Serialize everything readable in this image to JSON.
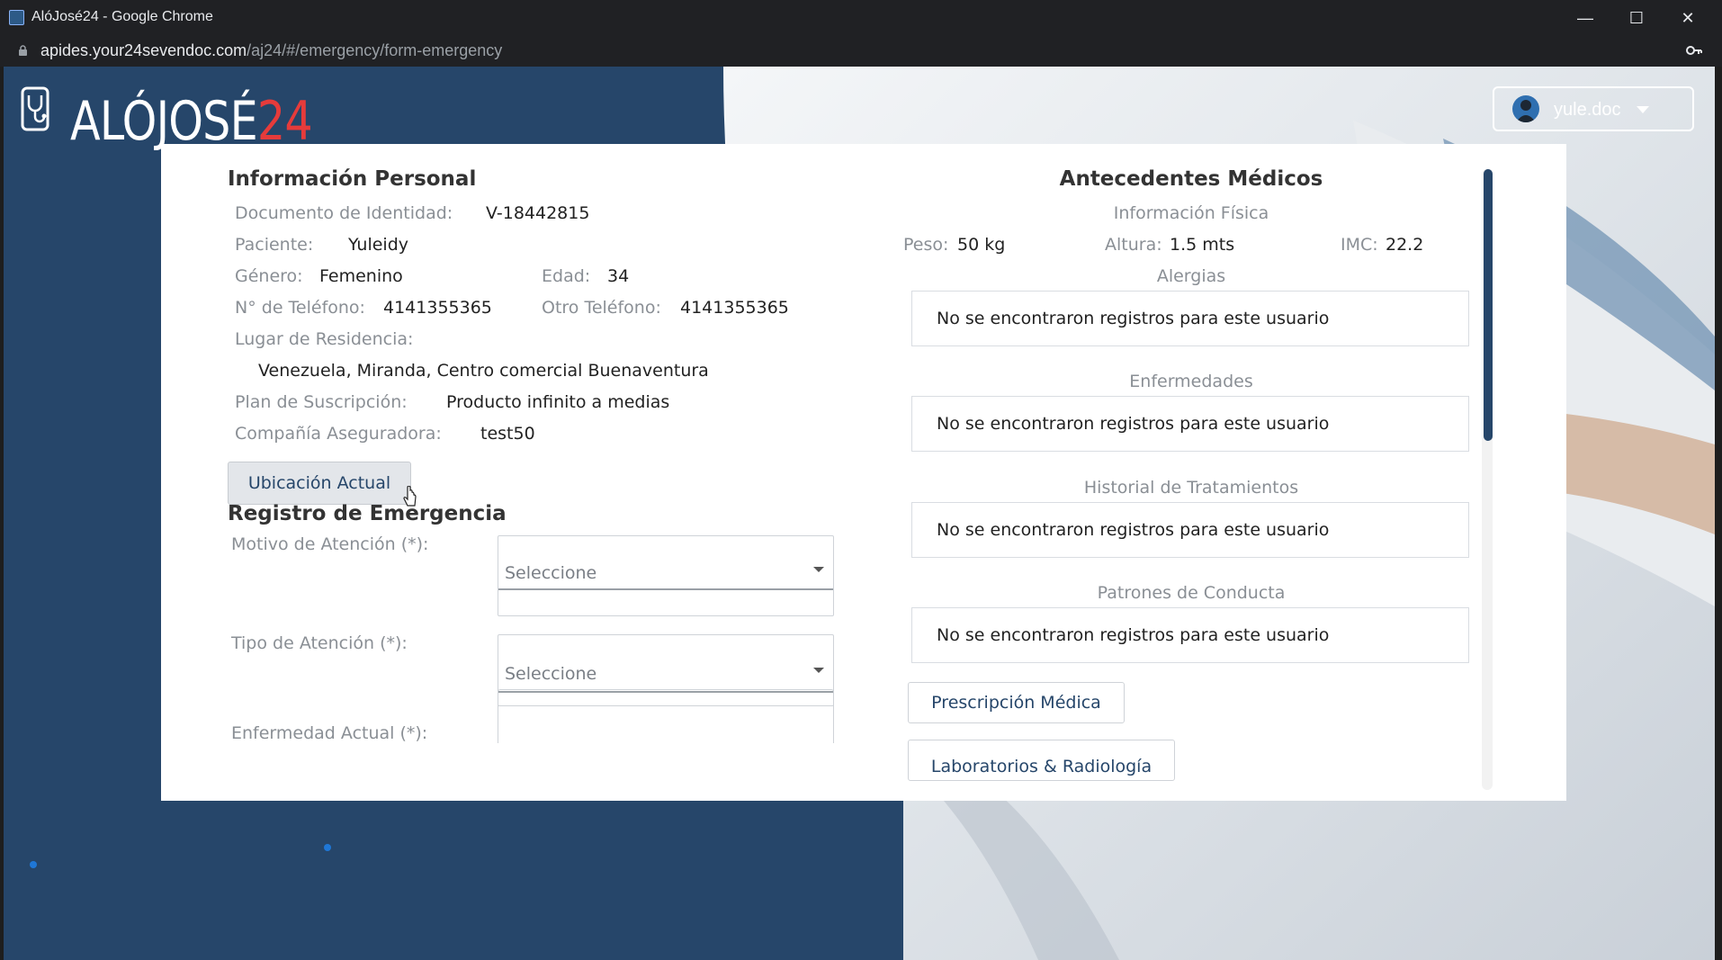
{
  "browser": {
    "window_title": "AlóJosé24 - Google Chrome",
    "url_domain": "apides.your24sevendoc.com",
    "url_path": "/aj24/#/emergency/form-emergency",
    "controls": {
      "minimize": "—",
      "maximize": "☐",
      "close": "✕"
    }
  },
  "header": {
    "logo_text": "ALÓJOSÉ",
    "logo_number": "24",
    "user_name": "yule.doc"
  },
  "personal_info": {
    "title": "Información Personal",
    "id_label": "Documento de Identidad:",
    "id_value": "V-18442815",
    "patient_label": "Paciente:",
    "patient_value": "Yuleidy",
    "gender_label": "Género:",
    "gender_value": "Femenino",
    "age_label": "Edad:",
    "age_value": "34",
    "phone_label": "N° de Teléfono:",
    "phone_value": "4141355365",
    "other_phone_label": "Otro Teléfono:",
    "other_phone_value": "4141355365",
    "residence_label": "Lugar de Residencia:",
    "residence_value": "Venezuela, Miranda, Centro comercial Buenaventura",
    "plan_label": "Plan de Suscripción:",
    "plan_value": "Producto infinito a medias",
    "insurer_label": "Compañía Aseguradora:",
    "insurer_value": "test50",
    "location_button": "Ubicación Actual"
  },
  "emergency": {
    "title": "Registro de Emergencia",
    "reason_label": "Motivo de Atención (*):",
    "reason_placeholder": "Seleccione",
    "type_label": "Tipo de Atención (*):",
    "type_placeholder": "Seleccione",
    "illness_label": "Enfermedad Actual (*):"
  },
  "medical_history": {
    "title": "Antecedentes Médicos",
    "physical_title": "Información Física",
    "weight_label": "Peso:",
    "weight_value": "50 kg",
    "height_label": "Altura:",
    "height_value": "1.5 mts",
    "bmi_label": "IMC:",
    "bmi_value": "22.2",
    "allergies_title": "Alergias",
    "allergies_value": "No se encontraron registros para este usuario",
    "diseases_title": "Enfermedades",
    "diseases_value": "No se encontraron registros para este usuario",
    "treatments_title": "Historial de Tratamientos",
    "treatments_value": "No se encontraron registros para este usuario",
    "behavior_title": "Patrones de Conducta",
    "behavior_value": "No se encontraron registros para este usuario",
    "prescription_button": "Prescripción Médica",
    "labs_button": "Laboratorios & Radiología"
  }
}
